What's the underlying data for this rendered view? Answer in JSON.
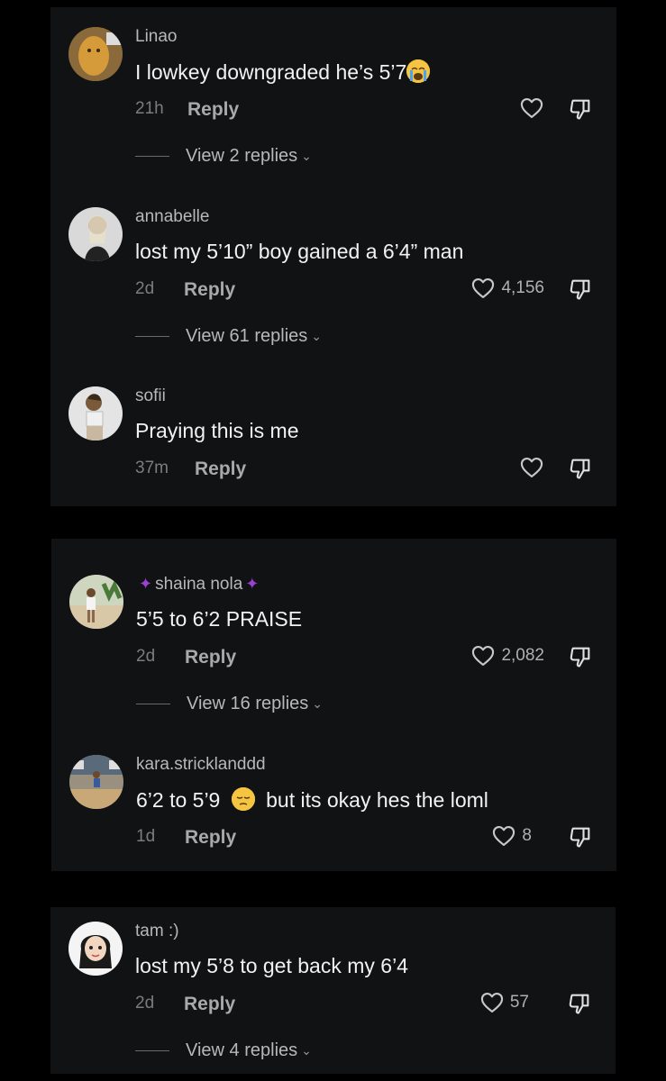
{
  "comments": [
    {
      "username": "Linao",
      "text": "I lowkey downgraded he’s 5’7",
      "time": "21h",
      "reply_label": "Reply",
      "likes": "",
      "view_replies": "View 2 replies"
    },
    {
      "username": "annabelle",
      "text": "lost my 5’10” boy gained a 6’4” man",
      "time": "2d",
      "reply_label": "Reply",
      "likes": "4,156",
      "view_replies": "View 61 replies"
    },
    {
      "username": "sofii",
      "text": "Praying this is me",
      "time": "37m",
      "reply_label": "Reply",
      "likes": "",
      "view_replies": ""
    },
    {
      "username": "shaina nola",
      "text": "5’5 to 6’2 PRAISE",
      "time": "2d",
      "reply_label": "Reply",
      "likes": "2,082",
      "view_replies": "View 16 replies"
    },
    {
      "username": "kara.stricklanddd",
      "text_before": "6’2 to 5’9",
      "text_after": "but its okay hes the loml",
      "time": "1d",
      "reply_label": "Reply",
      "likes": "8",
      "view_replies": ""
    },
    {
      "username": "tam :)",
      "text": "lost my 5’8 to get back my 6’4",
      "time": "2d",
      "reply_label": "Reply",
      "likes": "57",
      "view_replies": "View 4 replies"
    }
  ],
  "icons": {
    "like": "heart-icon",
    "dislike": "thumbs-down-icon",
    "expand": "chevron-down-icon"
  },
  "colors": {
    "background": "#000000",
    "panel": "#111214",
    "username": "#b8b8b8",
    "body_text": "#f2f2f2",
    "meta": "#7c7c7c",
    "dancer_emoji": "#9b3fd6"
  }
}
